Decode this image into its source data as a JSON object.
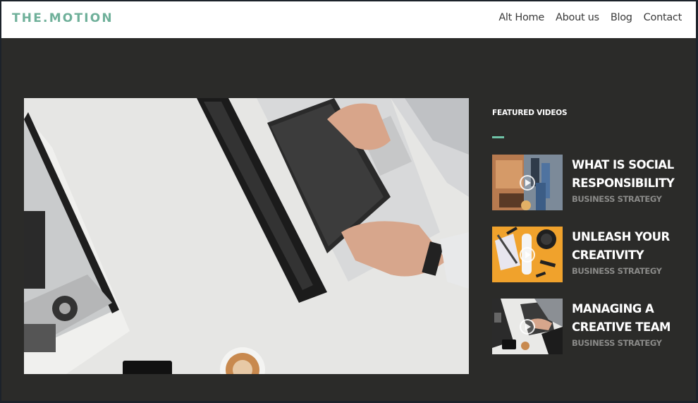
{
  "header": {
    "logo": "THE.MOTION",
    "nav": [
      {
        "label": "Alt Home"
      },
      {
        "label": "About us"
      },
      {
        "label": "Blog"
      },
      {
        "label": "Contact"
      }
    ]
  },
  "hero": {
    "image": "laptop-typing-desk-photo"
  },
  "sidebar": {
    "title": "FEATURED VIDEOS",
    "accent_color": "#6fc3a7",
    "videos": [
      {
        "title": "What is Social Responsibility",
        "category": "BUSINESS STRATEGY",
        "thumbnail": "office-team-stairs-photo"
      },
      {
        "title": "Unleash your Creativity",
        "category": "BUSINESS STRATEGY",
        "thumbnail": "orange-desk-flatlay-photo"
      },
      {
        "title": "Managing a Creative Team",
        "category": "BUSINESS STRATEGY",
        "thumbnail": "laptop-desk-photo"
      }
    ]
  },
  "colors": {
    "logo": "#6fb09a",
    "background": "#2b2b29",
    "header": "#ffffff"
  }
}
